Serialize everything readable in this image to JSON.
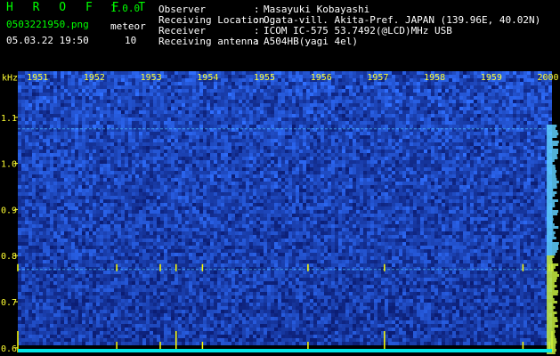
{
  "app": {
    "name": "H R O F F T",
    "version": "1.0.0",
    "file_name": "0503221950.png",
    "timestamp": "05.03.22 19:50"
  },
  "meteor": {
    "label": "meteor",
    "count": "10"
  },
  "station_info": [
    {
      "label": "Observer",
      "value": "Masayuki Kobayashi"
    },
    {
      "label": "Receiving Location",
      "value": "Ogata-vill. Akita-Pref. JAPAN (139.96E, 40.02N)"
    },
    {
      "label": "Receiver",
      "value": "ICOM IC-575 53.7492(@LCD)MHz USB"
    },
    {
      "label": "Receiving antenna",
      "value": "A504HB(yagi 4el)"
    }
  ],
  "chart_data": {
    "type": "heatmap",
    "ylabel": "kHz",
    "x_ticks": [
      "1951",
      "1952",
      "1953",
      "1954",
      "1955",
      "1956",
      "1957",
      "1958",
      "1959",
      "2000"
    ],
    "y_ticks": [
      "1.1",
      "1.0",
      "0.9",
      "0.8",
      "0.7",
      "0.6"
    ],
    "y_tick_values": [
      1.1,
      1.0,
      0.9,
      0.8,
      0.7,
      0.6
    ],
    "x_range_minutes": [
      19.5,
      60.0
    ],
    "y_range_khz": [
      0.59,
      1.2
    ],
    "meteor_echo_minutes": [
      19.5,
      27.0,
      30.3,
      31.5,
      33.5,
      41.5,
      47.3,
      57.8,
      59.8,
      60.0
    ],
    "carrier_lines_khz": [
      1.075,
      0.77
    ],
    "colors": {
      "background": "#000000",
      "noise_low": "#0a1a6e",
      "noise_high": "#2f6fff",
      "signal": "#ffff00",
      "tick_label": "#ffff33",
      "power_trace": "#00e6e6"
    }
  }
}
